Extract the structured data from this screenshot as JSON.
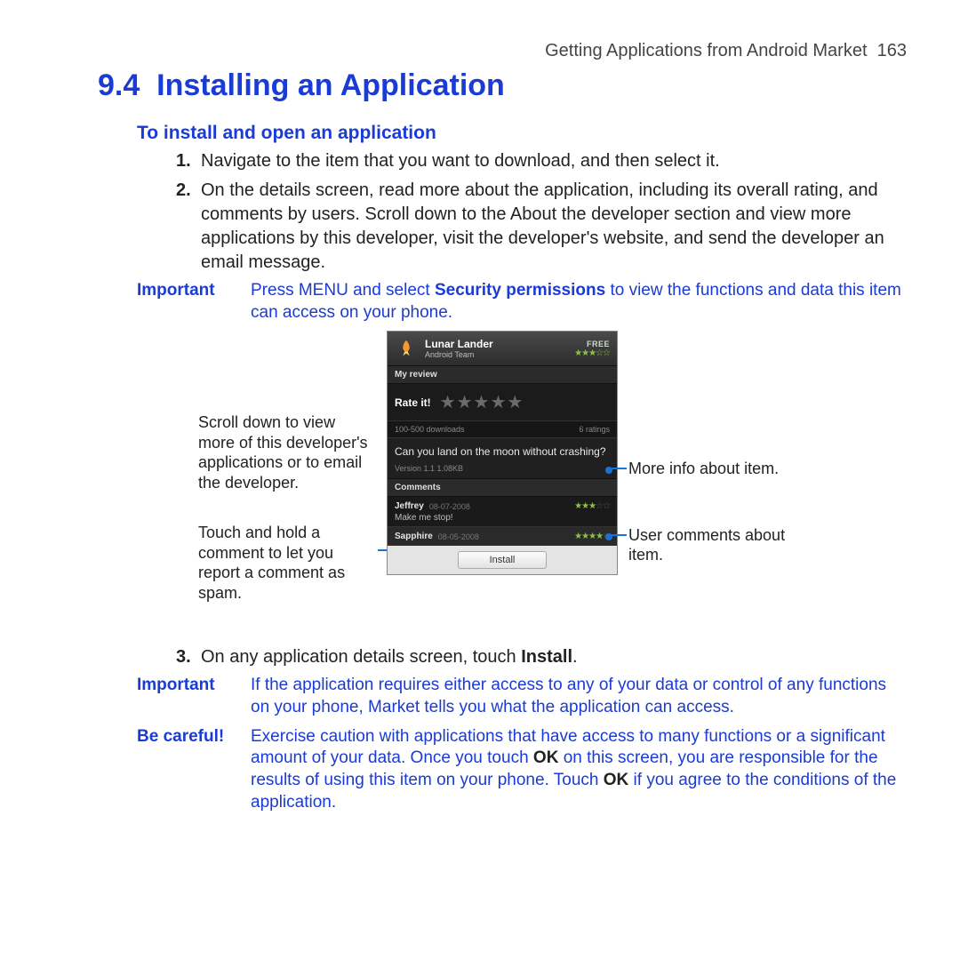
{
  "header": {
    "running_title": "Getting Applications from Android Market",
    "page_num": "163"
  },
  "section": {
    "number": "9.4",
    "title": "Installing an Application"
  },
  "subhead": "To install and open an application",
  "steps": [
    {
      "n": "1.",
      "text": "Navigate to the item that you want to download, and then select it."
    },
    {
      "n": "2.",
      "text": "On the details screen, read more about the application, including its overall rating, and comments by users. Scroll down to the About the developer section and view more applications by this developer, visit the developer's website, and send the developer an email message."
    },
    {
      "n": "3.",
      "pretext": "On any application details screen, touch ",
      "bold": "Install",
      "post": "."
    }
  ],
  "notes": {
    "important1": {
      "label": "Important",
      "pre": "Press MENU and select ",
      "bold": "Security permissions",
      "post": " to view the functions and data this item can access on your phone."
    },
    "important2": {
      "label": "Important",
      "text": "If the application requires either access to any of your data or control of any functions on your phone, Market tells you what the application can access."
    },
    "careful": {
      "label": "Be careful!",
      "pre": "Exercise caution with applications that have access to many functions or a significant amount of your data. Once you touch ",
      "b1": "OK",
      "mid": " on this screen, you are responsible for the results of using this item on your phone. Touch ",
      "b2": "OK",
      "post": " if you agree to the conditions of the application."
    }
  },
  "callouts": {
    "left1": "Scroll down to view more of this developer's applications or to email the developer.",
    "left2": "Touch and hold a comment to let you report a comment as spam.",
    "right1": "More info about item.",
    "right2": "User comments about item."
  },
  "screenshot": {
    "app_name": "Lunar Lander",
    "developer": "Android Team",
    "price": "FREE",
    "header_stars": "★★★☆☆",
    "my_review": "My review",
    "rate_label": "Rate it!",
    "rate_stars": "★★★★★",
    "downloads": "100-500 downloads",
    "ratings_count": "6 ratings",
    "description": "Can you land on the moon without crashing?",
    "version_line": "Version 1.1    1.08KB",
    "comments_header": "Comments",
    "comments": [
      {
        "name": "Jeffrey",
        "date": "08-07-2008",
        "stars": "★★★",
        "dim": "☆☆",
        "body": "Make me stop!"
      },
      {
        "name": "Sapphire",
        "date": "08-05-2008",
        "stars": "★★★★",
        "dim": "☆",
        "body": ""
      }
    ],
    "install_button": "Install"
  }
}
